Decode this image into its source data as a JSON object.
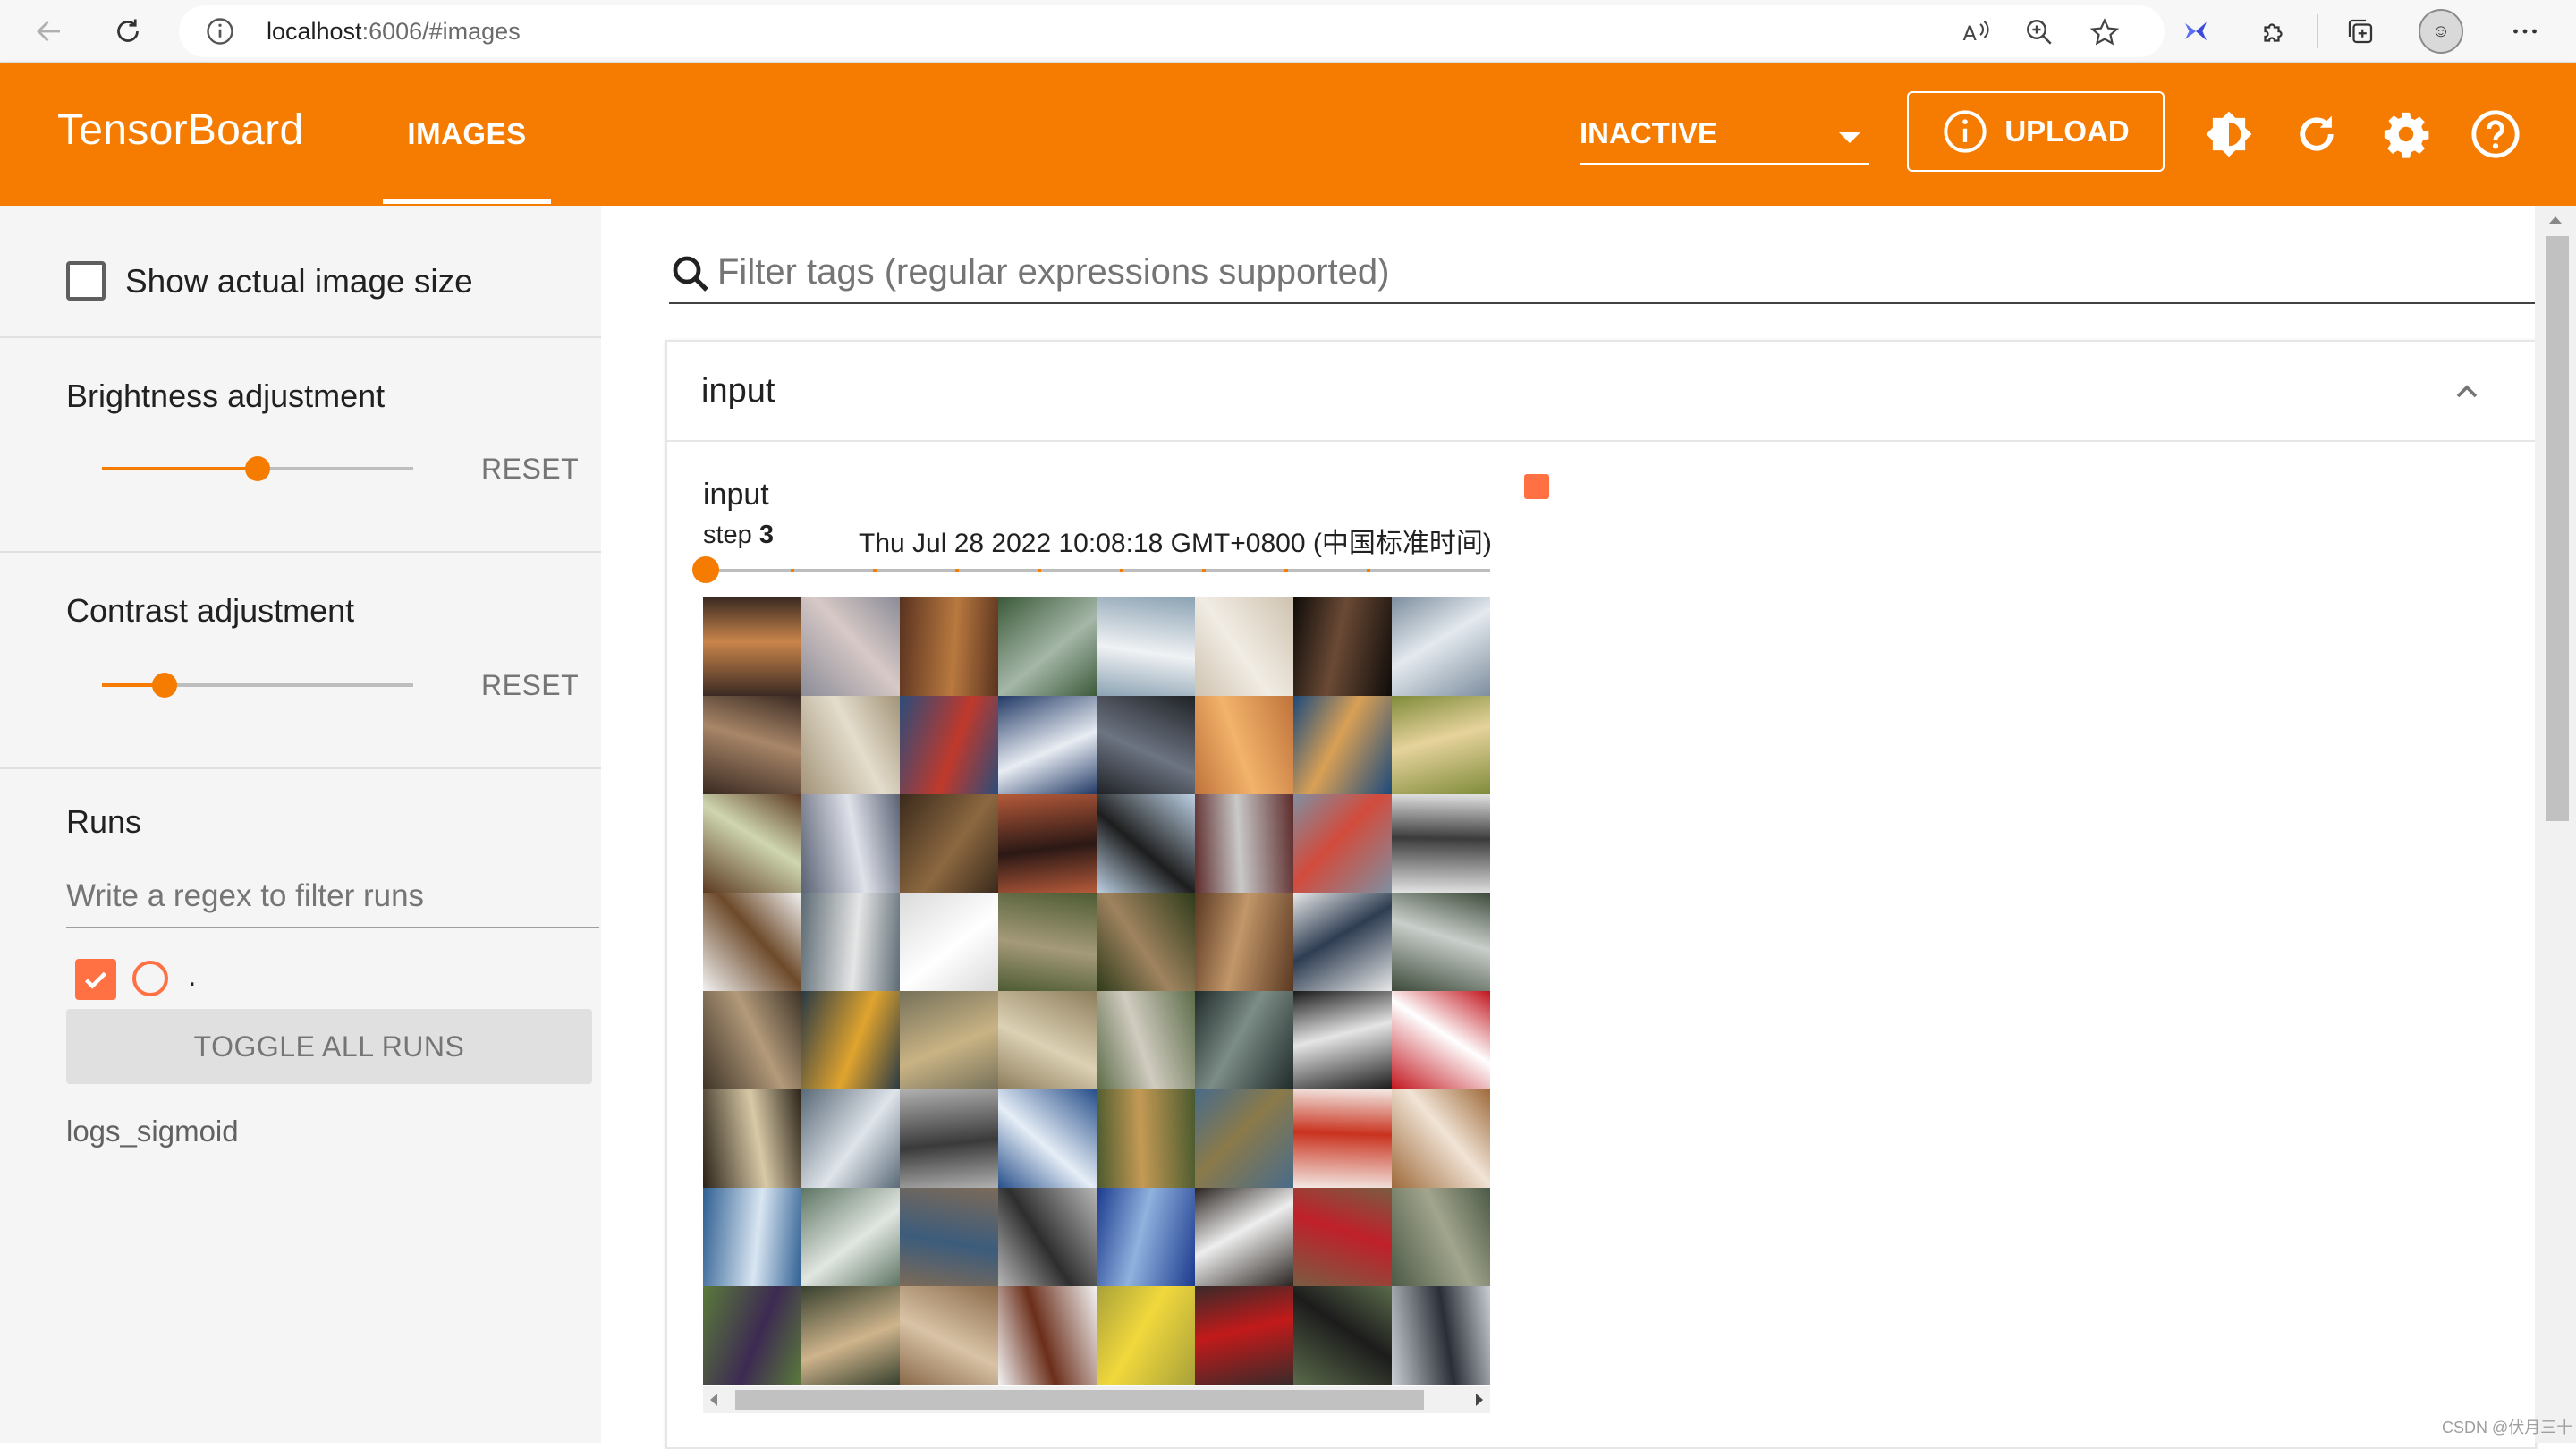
{
  "browser": {
    "url_host": "localhost",
    "url_path": ":6006/#images",
    "profile_icon": "profile-avatar-icon"
  },
  "header": {
    "brand": "TensorBoard",
    "active_tab": "IMAGES",
    "reload_status": "INACTIVE",
    "upload_label": "UPLOAD",
    "icons": [
      "theme-toggle-icon",
      "reload-icon",
      "settings-icon",
      "help-icon"
    ],
    "accent_color": "#f57c00"
  },
  "sidebar": {
    "show_actual_size_label": "Show actual image size",
    "show_actual_size_checked": false,
    "brightness": {
      "label": "Brightness adjustment",
      "value_fraction": 0.5,
      "reset_label": "RESET"
    },
    "contrast": {
      "label": "Contrast adjustment",
      "value_fraction": 0.2,
      "reset_label": "RESET"
    },
    "runs": {
      "title": "Runs",
      "filter_placeholder": "Write a regex to filter runs",
      "items": [
        {
          "name": ".",
          "checked": true,
          "color": "#ff7043"
        }
      ],
      "toggle_label": "TOGGLE ALL RUNS",
      "logdir": "logs_sigmoid"
    }
  },
  "main": {
    "filter_placeholder": "Filter tags (regular expressions supported)",
    "card": {
      "title": "input",
      "image": {
        "tag": "input",
        "step_label": "step",
        "step_value": "3",
        "timestamp": "Thu Jul 28 2022 10:08:18 GMT+0800 (中国标准时间)",
        "step_slider_fraction": 0.0
      }
    }
  },
  "watermark": "CSDN @伏月三十"
}
